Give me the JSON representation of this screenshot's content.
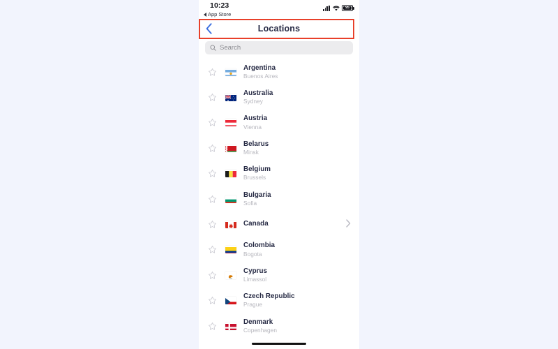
{
  "status_bar": {
    "time": "10:23",
    "back_app_label": "App Store",
    "back_arrow_icon": "triangle-left-icon",
    "cellular_icon": "signal-bars-icon",
    "wifi_icon": "wifi-icon",
    "battery_icon": "battery-icon",
    "battery_level": "95"
  },
  "nav_bar": {
    "title": "Locations",
    "back_icon": "chevron-left-icon",
    "highlight_color": "#e8402a",
    "accent_color": "#3b6fe0",
    "title_color": "#262a44"
  },
  "search": {
    "placeholder": "Search",
    "icon": "search-icon",
    "field_bg": "#ececee"
  },
  "list": {
    "favorite_icon": "star-outline-icon",
    "disclosure_icon": "chevron-right-icon",
    "items": [
      {
        "country": "Argentina",
        "city": "Buenos Aires",
        "flag": "ar",
        "has_chevron": false
      },
      {
        "country": "Australia",
        "city": "Sydney",
        "flag": "au",
        "has_chevron": false
      },
      {
        "country": "Austria",
        "city": "Vienna",
        "flag": "at",
        "has_chevron": false
      },
      {
        "country": "Belarus",
        "city": "Minsk",
        "flag": "by",
        "has_chevron": false
      },
      {
        "country": "Belgium",
        "city": "Brussels",
        "flag": "be",
        "has_chevron": false
      },
      {
        "country": "Bulgaria",
        "city": "Sofia",
        "flag": "bg",
        "has_chevron": false
      },
      {
        "country": "Canada",
        "city": "",
        "flag": "ca",
        "has_chevron": true
      },
      {
        "country": "Colombia",
        "city": "Bogota",
        "flag": "co",
        "has_chevron": false
      },
      {
        "country": "Cyprus",
        "city": "Limassol",
        "flag": "cy",
        "has_chevron": false
      },
      {
        "country": "Czech Republic",
        "city": "Prague",
        "flag": "cz",
        "has_chevron": false
      },
      {
        "country": "Denmark",
        "city": "Copenhagen",
        "flag": "dk",
        "has_chevron": false
      }
    ]
  },
  "home_indicator": {
    "label": "home-indicator"
  }
}
